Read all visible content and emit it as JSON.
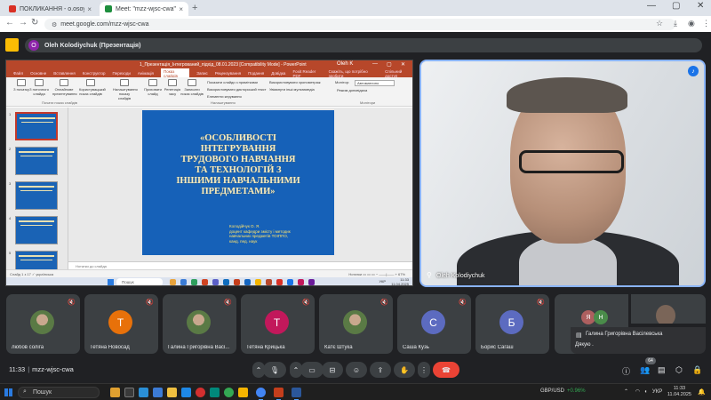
{
  "browser": {
    "tabs": [
      {
        "label": "ПОКЛИКАННЯ - o.osoy.k@gp...",
        "color": "#d93025"
      },
      {
        "label": "Meet: \"mzz-wjsc-cwa\"",
        "color": "#1e8e3e"
      }
    ],
    "url": "meet.google.com/mzz-wjsc-cwa",
    "new_tab_icon": "plus-icon"
  },
  "presentation_bar": {
    "presenter_initial": "O",
    "presenter_label": "Oleh Kolodiychuk (Презентація)"
  },
  "powerpoint": {
    "file_title": "1_Презентація_Інтегрований_підхід_08.01.2023 [Compatibility Mode] - PowerPoint",
    "user": "Oleh K",
    "menu": [
      "Файл",
      "Основне",
      "Вставлення",
      "Конструктор",
      "Переходи",
      "Анімація",
      "Показ слайдів",
      "Запис",
      "Рецензування",
      "Подання",
      "Довідка",
      "Foxit Reader PDF",
      "Скажіть, що потрібно зробити",
      "Спільний доступ"
    ],
    "selected_menu_index": 6,
    "ribbon_groups": [
      "З початку",
      "З поточного слайда",
      "Онлайнове презентування",
      "Користувацький показ слайдів",
      "Налаштування показу слайдів",
      "Приховати слайд",
      "Репетиція часу",
      "Записати показ слайдів"
    ],
    "ribbon_checks": [
      "Показати слайди з примітками",
      "Використовувати дикторський текст",
      "Елементи керування"
    ],
    "ribbon_checks2": [
      "Використовувати хронометраж",
      "Увімкнути інші мультимедіа"
    ],
    "monitor_label": "Монітор:",
    "monitor_value": "Автоматично",
    "presenter_view_label": "Режим доповідача",
    "group_captions": [
      "Почати показ слайдів",
      "Налаштування",
      "Монітори"
    ],
    "slide_numbers": [
      "1",
      "2",
      "3",
      "4",
      "5"
    ],
    "slide_title": "«ОСОБЛИВОСТІ\nІНТЕГРУВАННЯ\nТРУДОВОГО НАВЧАННЯ\nТА ТЕХНОЛОГІЙ З\nІНШИМИ НАВЧАЛЬНИМИ\nПРЕДМЕТАМИ»",
    "slide_author": "Колодійчук О. Я.\nдоцент кафедри змісту і методик\nнавчальних предметів ТОІППО,\nканд. пед. наук",
    "notes_placeholder": "Нотатки до слайда",
    "status_left": "Слайд 1 з 17   ✓  українська",
    "status_right": "Нотатки   ▭ ▭ ▭   −  ——|——  +  67%",
    "inner_search": "Пошук",
    "inner_clock": "11:33\n11.04.2025",
    "inner_lang": "УКР"
  },
  "speaker": {
    "name": "Oleh Kolodiychuk"
  },
  "participants": [
    {
      "name": "любов солiга",
      "initial": "",
      "color": "",
      "photo": true
    },
    {
      "name": "Тетяна Новосад",
      "initial": "Т",
      "color": "#e8710a",
      "photo": false
    },
    {
      "name": "Галина Григорiвна Васі...",
      "initial": "",
      "color": "",
      "photo": true
    },
    {
      "name": "Тетяна Крицька",
      "initial": "Т",
      "color": "#c2185b",
      "photo": false
    },
    {
      "name": "Катє Штука",
      "initial": "",
      "color": "",
      "photo": true
    },
    {
      "name": "Саша Кузь",
      "initial": "С",
      "color": "#5c6bc0",
      "photo": false
    },
    {
      "name": "Борис Сагаш",
      "initial": "Б",
      "color": "#5c6bc0",
      "photo": false
    }
  ],
  "more_tile": {
    "initial_a": "Я",
    "initial_b": "Н"
  },
  "chat_toast": {
    "sender": "Галина Григорiвна Васiлевська",
    "message": "Дякую ."
  },
  "controls": {
    "time": "11:33",
    "separator": "|",
    "meeting_code": "mzz-wjsc-cwa",
    "people_count": "64"
  },
  "taskbar": {
    "search": "Пошук",
    "stock_name": "GBP/USD",
    "stock_change": "+0.96%",
    "lang": "УКР",
    "time": "11:33",
    "date": "11.04.2025"
  }
}
